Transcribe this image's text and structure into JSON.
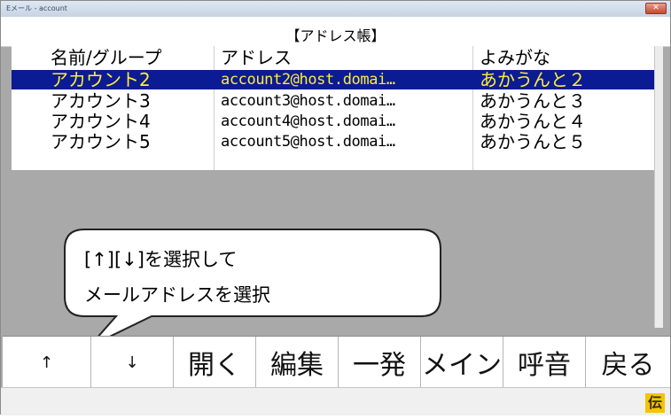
{
  "window": {
    "title": "Eメール - account",
    "close_label": "✕"
  },
  "header": {
    "title": "【アドレス帳】"
  },
  "table": {
    "columns": [
      "名前/グループ",
      "アドレス",
      "よみがな"
    ],
    "rows": [
      {
        "name": "アカウント2",
        "address": "account2@host.domai…",
        "reading": "あかうんと２",
        "selected": true
      },
      {
        "name": "アカウント3",
        "address": "account3@host.domai…",
        "reading": "あかうんと３",
        "selected": false
      },
      {
        "name": "アカウント4",
        "address": "account4@host.domai…",
        "reading": "あかうんと４",
        "selected": false
      },
      {
        "name": "アカウント5",
        "address": "account5@host.domai…",
        "reading": "あかうんと５",
        "selected": false
      }
    ]
  },
  "tooltip": {
    "line1": "[↑][↓]を選択して",
    "line2": "メールアドレスを選択"
  },
  "toolbar": {
    "buttons": [
      "↑",
      "↓",
      "開く",
      "編集",
      "一発",
      "メイン",
      "呼音",
      "戻る"
    ]
  },
  "status": {
    "badge": "伝"
  },
  "colors": {
    "selection_bg": "#0b1b93",
    "selection_fg": "#ffec3d",
    "badge": "#f2c500"
  }
}
